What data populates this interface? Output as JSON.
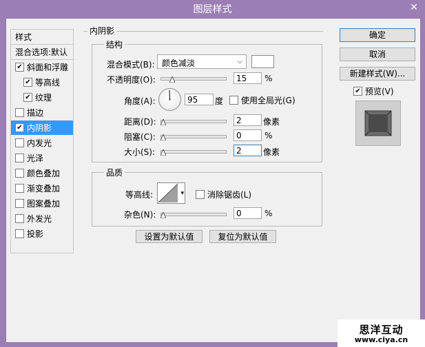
{
  "window": {
    "title": "图层样式",
    "close_glyph": "✕"
  },
  "left_panel": {
    "header": "样式",
    "blend_options": "混合选项:默认",
    "items": [
      {
        "label": "斜面和浮雕",
        "checked": true,
        "indent": false
      },
      {
        "label": "等高线",
        "checked": true,
        "indent": true
      },
      {
        "label": "纹理",
        "checked": true,
        "indent": true
      },
      {
        "label": "描边",
        "checked": false,
        "indent": false
      },
      {
        "label": "内阴影",
        "checked": true,
        "indent": false,
        "selected": true
      },
      {
        "label": "内发光",
        "checked": false,
        "indent": false
      },
      {
        "label": "光泽",
        "checked": false,
        "indent": false
      },
      {
        "label": "颜色叠加",
        "checked": false,
        "indent": false
      },
      {
        "label": "渐变叠加",
        "checked": false,
        "indent": false
      },
      {
        "label": "图案叠加",
        "checked": false,
        "indent": false
      },
      {
        "label": "外发光",
        "checked": false,
        "indent": false
      },
      {
        "label": "投影",
        "checked": false,
        "indent": false
      }
    ]
  },
  "inner_shadow": {
    "section_title": "内阴影",
    "structure": {
      "title": "结构",
      "blend_mode_label": "混合模式(B):",
      "blend_mode_value": "颜色减淡",
      "opacity_label": "不透明度(O):",
      "opacity_value": "15",
      "opacity_fraction": 0.15,
      "percent": "%",
      "angle_label": "角度(A):",
      "angle_value": "95",
      "angle_unit": "度",
      "global_light_label": "使用全局光(G)",
      "distance_label": "距离(D):",
      "distance_value": "2",
      "choke_label": "阻塞(C):",
      "choke_value": "0",
      "size_label": "大小(S):",
      "size_value": "2",
      "px_unit": "像素"
    },
    "quality": {
      "title": "品质",
      "contour_label": "等高线:",
      "anti_alias_label": "消除锯齿(L)",
      "noise_label": "杂色(N):",
      "noise_value": "0",
      "percent": "%"
    },
    "make_default": "设置为默认值",
    "reset_default": "复位为默认值"
  },
  "right_panel": {
    "ok": "确定",
    "cancel": "取消",
    "new_style": "新建样式(W)...",
    "preview_label": "预览(V)",
    "preview_checked": true
  },
  "watermark": {
    "brand": "思洋互动",
    "url": "www.ciya.cn"
  },
  "colors": {
    "title_bar": "#9b7fb4",
    "selection": "#3399ff",
    "dialog_bg": "#f0f0f0"
  }
}
